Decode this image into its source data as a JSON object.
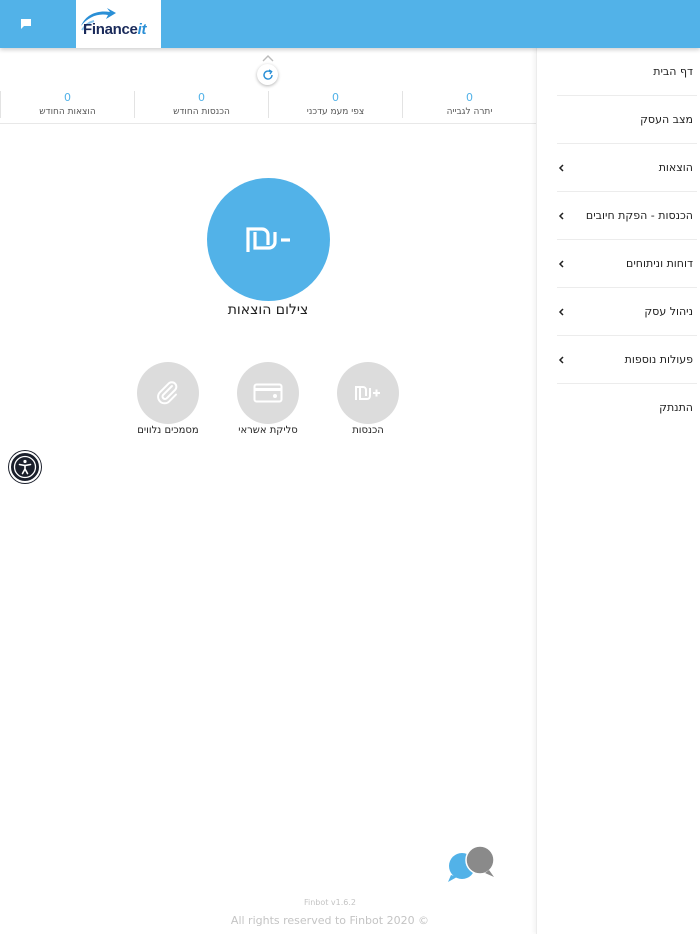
{
  "header": {
    "logo": {
      "main": "Finance",
      "accent": "it"
    },
    "colors": {
      "bar": "#52b2e8",
      "logo_text": "#1a2a5a",
      "logo_accent": "#2a8fd6"
    },
    "chat_icon": "chat-icon"
  },
  "sidebar": {
    "items": [
      {
        "label": "דף הבית",
        "has_submenu": false
      },
      {
        "label": "מצב העסק",
        "has_submenu": false
      },
      {
        "label": "הוצאות",
        "has_submenu": true
      },
      {
        "label": "הכנסות - הפקת חיובים",
        "has_submenu": true
      },
      {
        "label": "דוחות וניתוחים",
        "has_submenu": true
      },
      {
        "label": "ניהול עסק",
        "has_submenu": true
      },
      {
        "label": "פעולות נוספות",
        "has_submenu": true
      },
      {
        "label": "התנתק",
        "has_submenu": false
      }
    ],
    "chevron_icon": "chevron-left-icon"
  },
  "stats": {
    "items": [
      {
        "value": "0",
        "label": "יתרה לגבייה"
      },
      {
        "value": "0",
        "label": "צפי מעמ עדכני"
      },
      {
        "value": "0",
        "label": "הכנסות החודש"
      },
      {
        "value": "0",
        "label": "הוצאות החודש"
      }
    ],
    "refresh_icon": "refresh-icon",
    "collapse_icon": "chevron-up-icon"
  },
  "main_action": {
    "label": "צילום הוצאות",
    "icon": "shekel-minus-icon",
    "color": "#52b2e8"
  },
  "secondary_actions": [
    {
      "label": "הכנסות",
      "icon": "shekel-plus-icon"
    },
    {
      "label": "סליקת אשראי",
      "icon": "credit-card-icon"
    },
    {
      "label": "מסמכים נלווים",
      "icon": "paperclip-icon"
    }
  ],
  "footer": {
    "version": "Finbot v1.6.2",
    "copyright": "All rights reserved to Finbot 2020 ©"
  },
  "accessibility_icon": "accessibility-icon",
  "support_chat_icon": "chat-bubbles-icon"
}
